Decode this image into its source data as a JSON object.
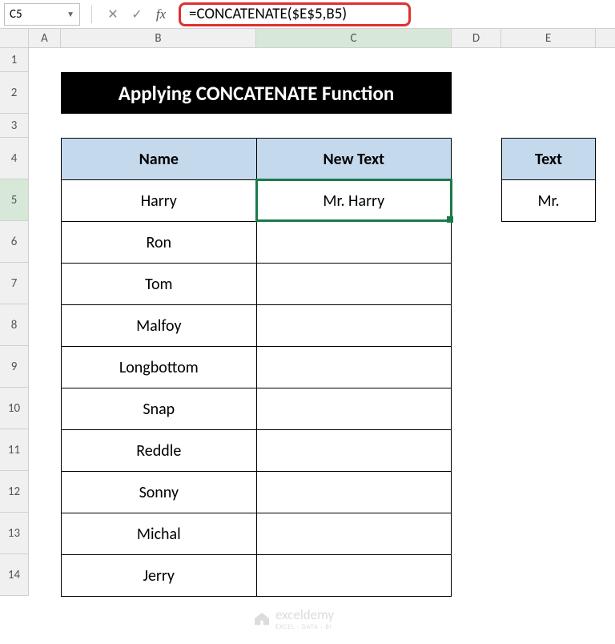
{
  "nameBox": "C5",
  "formula": "=CONCATENATE($E$5,B5)",
  "columns": [
    "A",
    "B",
    "C",
    "D",
    "E"
  ],
  "rowLabels": [
    "1",
    "2",
    "3",
    "4",
    "5",
    "6",
    "7",
    "8",
    "9",
    "10",
    "11",
    "12",
    "13",
    "14"
  ],
  "title": "Applying CONCATENATE Function",
  "headers": {
    "name": "Name",
    "newText": "New Text",
    "text": "Text"
  },
  "names": [
    "Harry",
    "Ron",
    "Tom",
    "Malfoy",
    "Longbottom",
    "Snap",
    "Reddle",
    "Sonny",
    "Michal",
    "Jerry"
  ],
  "newTexts": [
    "Mr. Harry",
    "",
    "",
    "",
    "",
    "",
    "",
    "",
    "",
    ""
  ],
  "textValue": "Mr. ",
  "watermark": {
    "brand": "exceldemy",
    "tagline": "EXCEL · DATA · BI"
  },
  "activeCellRef": "C5",
  "colors": {
    "headerFill": "#c5d9ed",
    "selection": "#1a7a4a",
    "highlight": "#e03030"
  }
}
